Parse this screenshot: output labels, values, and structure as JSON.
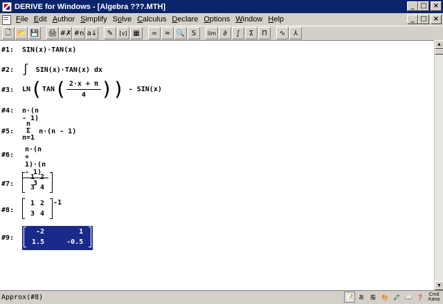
{
  "window": {
    "title": "DERIVE for Windows - [Algebra  ???.MTH]",
    "controls": [
      "_",
      "□",
      "×"
    ]
  },
  "menu": {
    "items": [
      {
        "label": "File",
        "ul": "F",
        "rest": "ile"
      },
      {
        "label": "Edit",
        "ul": "E",
        "rest": "dit"
      },
      {
        "label": "Author",
        "ul": "A",
        "rest": "uthor"
      },
      {
        "label": "Simplify",
        "ul": "S",
        "rest": "implify"
      },
      {
        "label": "Solve",
        "pre": "S",
        "ul": "o",
        "rest": "lve"
      },
      {
        "label": "Calculus",
        "ul": "C",
        "rest": "alculus"
      },
      {
        "label": "Declare",
        "ul": "D",
        "rest": "eclare"
      },
      {
        "label": "Options",
        "ul": "O",
        "rest": "ptions"
      },
      {
        "label": "Window",
        "ul": "W",
        "rest": "indow"
      },
      {
        "label": "Help",
        "ul": "H",
        "rest": "elp"
      }
    ],
    "controls": [
      "_",
      "□",
      "×"
    ]
  },
  "toolbar": {
    "buttons": [
      {
        "name": "new-icon",
        "glyph": "🗋"
      },
      {
        "name": "open-icon",
        "glyph": "📂"
      },
      {
        "name": "save-icon",
        "glyph": "💾"
      },
      {
        "sep": true
      },
      {
        "name": "print-icon",
        "glyph": "🖨"
      },
      {
        "name": "delete-icon",
        "glyph": "#✗"
      },
      {
        "name": "renumber-icon",
        "glyph": "#n"
      },
      {
        "name": "cut-icon",
        "glyph": "a↓"
      },
      {
        "sep": true
      },
      {
        "name": "author-expression-icon",
        "glyph": "✎"
      },
      {
        "name": "author-vector-icon",
        "glyph": "[v]"
      },
      {
        "name": "author-matrix-icon",
        "glyph": "▦"
      },
      {
        "sep": true
      },
      {
        "name": "simplify-icon",
        "glyph": "="
      },
      {
        "name": "approximate-icon",
        "glyph": "≈"
      },
      {
        "name": "solve-icon",
        "glyph": "🔍"
      },
      {
        "name": "substitute-icon",
        "glyph": "S"
      },
      {
        "sep": true
      },
      {
        "name": "limit-icon",
        "glyph": "lim"
      },
      {
        "name": "derivative-icon",
        "glyph": "∂"
      },
      {
        "name": "integral-icon",
        "glyph": "∫"
      },
      {
        "name": "sum-icon",
        "glyph": "Σ"
      },
      {
        "name": "product-icon",
        "glyph": "Π"
      },
      {
        "sep": true
      },
      {
        "name": "2d-plot-icon",
        "glyph": "∿"
      },
      {
        "name": "3d-plot-icon",
        "glyph": "⅄"
      }
    ]
  },
  "expressions": [
    {
      "label": "#1:",
      "text": "SIN(x)·TAN(x)"
    },
    {
      "label": "#2:",
      "integral": "∫",
      "text": "SIN(x)·TAN(x) dx"
    },
    {
      "label": "#3:",
      "pre": "LN",
      "tan": "TAN",
      "num": "2·x + π",
      "den": "4",
      "post": "- SIN(x)"
    },
    {
      "label": "#4:",
      "text": "n·(n - 1)"
    },
    {
      "label": "#5:",
      "sum_top": "n",
      "sum": "Σ",
      "sum_bottom": "n=1",
      "text": "n·(n - 1)"
    },
    {
      "label": "#6:",
      "num": "n·(n + 1)·(n - 1)",
      "den": "3"
    },
    {
      "label": "#7:",
      "matrix": [
        [
          "1",
          "2"
        ],
        [
          "3",
          "4"
        ]
      ]
    },
    {
      "label": "#8:",
      "matrix": [
        [
          "1",
          "2"
        ],
        [
          "3",
          "4"
        ]
      ],
      "exponent": "-1"
    },
    {
      "label": "#9:",
      "matrix": [
        [
          "-2",
          "1"
        ],
        [
          "1.5",
          "-0.5"
        ]
      ],
      "selected": true
    }
  ],
  "status": {
    "text": "Approx(#8)",
    "cmd_label": "Cmd\nKana"
  }
}
